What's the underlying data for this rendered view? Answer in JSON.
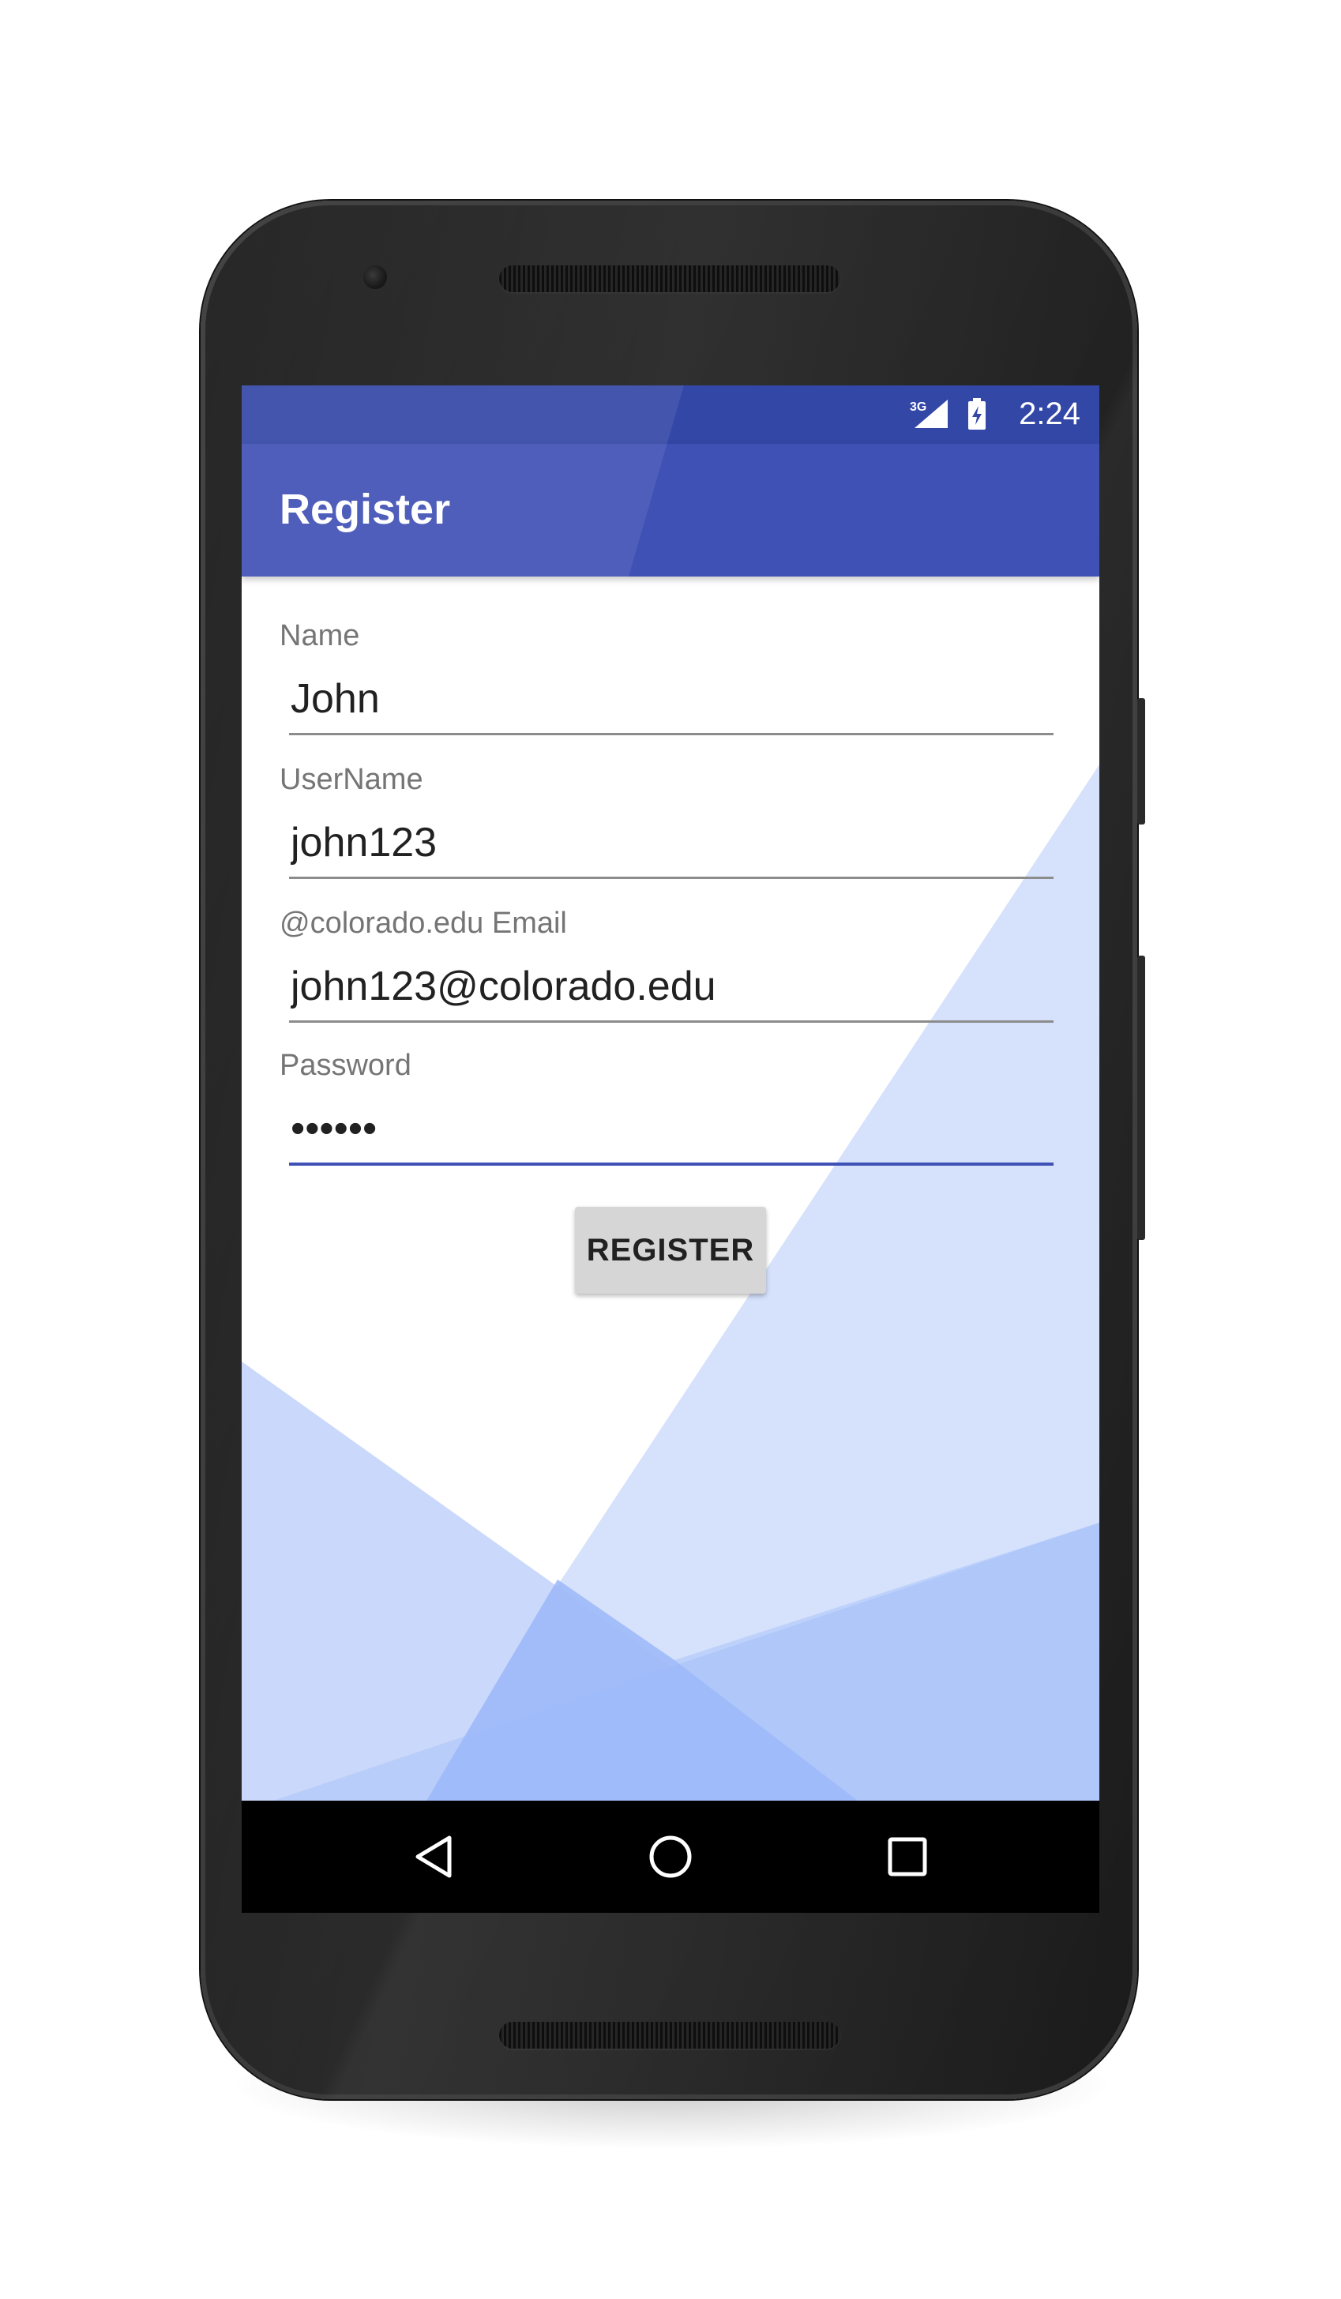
{
  "status_bar": {
    "network": "3G",
    "time": "2:24",
    "color": "#3347a6"
  },
  "app_bar": {
    "title": "Register",
    "color": "#3f51b5"
  },
  "form": {
    "fields": [
      {
        "label": "Name",
        "value": "John",
        "type": "text"
      },
      {
        "label": "UserName",
        "value": "john123",
        "type": "text"
      },
      {
        "label": "@colorado.edu Email",
        "value": "john123@colorado.edu",
        "type": "email"
      },
      {
        "label": "Password",
        "value": "••••••",
        "type": "password"
      }
    ],
    "submit_label": "REGISTER"
  },
  "nav_bar": {
    "back_icon": "back-triangle-icon",
    "home_icon": "home-circle-icon",
    "recents_icon": "recents-square-icon"
  },
  "colors": {
    "primary": "#3f51b5",
    "primary_dark": "#3347a6",
    "background_accent": "#d6e2fc"
  }
}
